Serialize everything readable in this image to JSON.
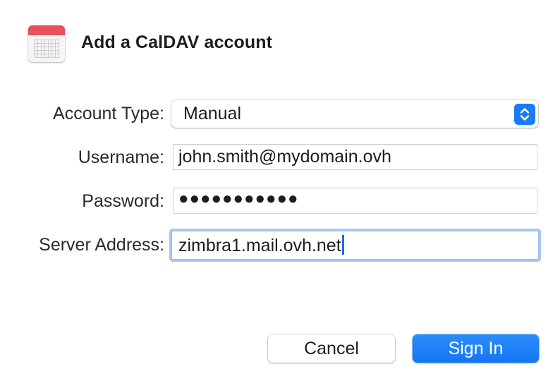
{
  "dialog": {
    "title": "Add a CalDAV account",
    "icon": "calendar-icon"
  },
  "form": {
    "account_type": {
      "label": "Account Type:",
      "value": "Manual",
      "icon": "chevron-up-down-icon"
    },
    "username": {
      "label": "Username:",
      "value": "john.smith@mydomain.ovh"
    },
    "password": {
      "label": "Password:",
      "masked_value": "●●●●●●●●●●●"
    },
    "server_address": {
      "label": "Server Address:",
      "value": "zimbra1.mail.ovh.net",
      "focused": true
    }
  },
  "buttons": {
    "cancel_label": "Cancel",
    "sign_in_label": "Sign In"
  },
  "colors": {
    "accent": "#1a7cf5",
    "calendar_red": "#e8505b",
    "focus_ring": "#a7c6f2"
  }
}
